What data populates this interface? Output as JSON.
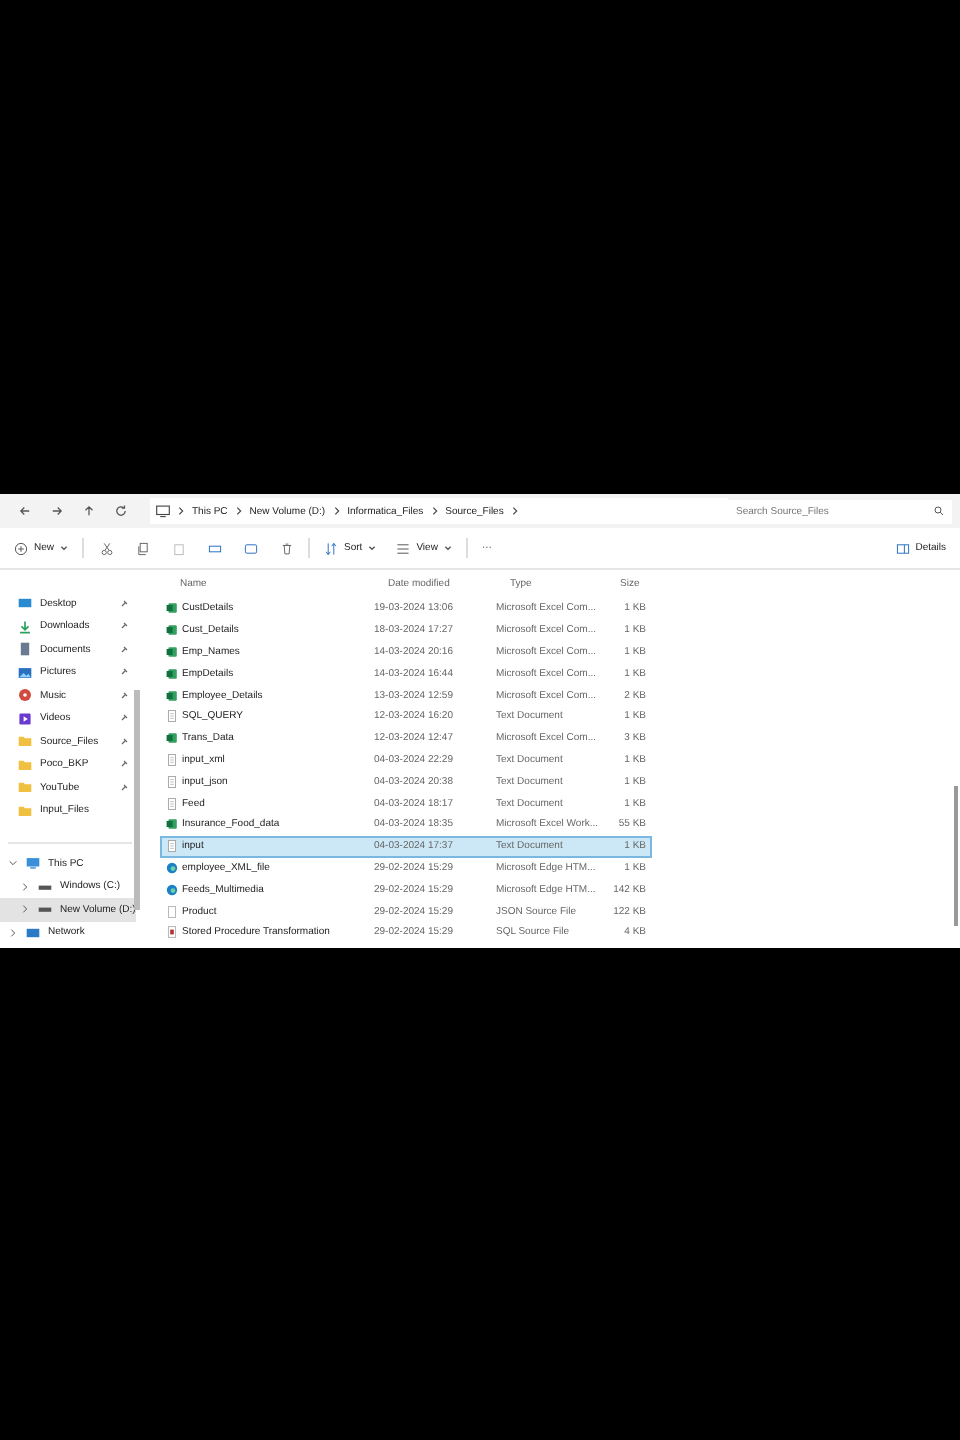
{
  "address_bar": {
    "crumbs": [
      "This PC",
      "New Volume (D:)",
      "Informatica_Files",
      "Source_Files"
    ],
    "search": {
      "placeholder": "Search Source_Files"
    }
  },
  "toolbar": {
    "new": "New",
    "sort": "Sort",
    "view": "View",
    "more": "···",
    "details": "Details"
  },
  "sidebar": {
    "quick_access": [
      {
        "label": "Desktop",
        "pinned": true
      },
      {
        "label": "Downloads",
        "pinned": true
      },
      {
        "label": "Documents",
        "pinned": true
      },
      {
        "label": "Pictures",
        "pinned": true
      },
      {
        "label": "Music",
        "pinned": true
      },
      {
        "label": "Videos",
        "pinned": true
      },
      {
        "label": "Source_Files",
        "pinned": true
      },
      {
        "label": "Poco_BKP",
        "pinned": true
      },
      {
        "label": "YouTube",
        "pinned": true
      },
      {
        "label": "Input_Files",
        "pinned": false
      }
    ],
    "tree": [
      {
        "label": "This PC",
        "expanded": true,
        "selected": false,
        "children": [
          {
            "label": "Windows (C:)",
            "expanded": false,
            "selected": false
          },
          {
            "label": "New Volume (D:)",
            "expanded": false,
            "selected": true
          }
        ]
      },
      {
        "label": "Network",
        "expanded": false,
        "selected": false
      }
    ]
  },
  "table": {
    "columns": [
      "Name",
      "Date modified",
      "Type",
      "Size"
    ],
    "rows": [
      {
        "kind": "excel",
        "name": "CustDetails",
        "date": "19-03-2024 13:06",
        "type": "Microsoft Excel Com...",
        "size": "1 KB",
        "selected": false
      },
      {
        "kind": "excel",
        "name": "Cust_Details",
        "date": "18-03-2024 17:27",
        "type": "Microsoft Excel Com...",
        "size": "1 KB",
        "selected": false
      },
      {
        "kind": "excel",
        "name": "Emp_Names",
        "date": "14-03-2024 20:16",
        "type": "Microsoft Excel Com...",
        "size": "1 KB",
        "selected": false
      },
      {
        "kind": "excel",
        "name": "EmpDetails",
        "date": "14-03-2024 16:44",
        "type": "Microsoft Excel Com...",
        "size": "1 KB",
        "selected": false
      },
      {
        "kind": "excel",
        "name": "Employee_Details",
        "date": "13-03-2024 12:59",
        "type": "Microsoft Excel Com...",
        "size": "2 KB",
        "selected": false
      },
      {
        "kind": "text",
        "name": "SQL_QUERY",
        "date": "12-03-2024 16:20",
        "type": "Text Document",
        "size": "1 KB",
        "selected": false
      },
      {
        "kind": "excel",
        "name": "Trans_Data",
        "date": "12-03-2024 12:47",
        "type": "Microsoft Excel Com...",
        "size": "3 KB",
        "selected": false
      },
      {
        "kind": "text",
        "name": "input_xml",
        "date": "04-03-2024 22:29",
        "type": "Text Document",
        "size": "1 KB",
        "selected": false
      },
      {
        "kind": "text",
        "name": "input_json",
        "date": "04-03-2024 20:38",
        "type": "Text Document",
        "size": "1 KB",
        "selected": false
      },
      {
        "kind": "text",
        "name": "Feed",
        "date": "04-03-2024 18:17",
        "type": "Text Document",
        "size": "1 KB",
        "selected": false
      },
      {
        "kind": "excel",
        "name": "Insurance_Food_data",
        "date": "04-03-2024 18:35",
        "type": "Microsoft Excel Work...",
        "size": "55 KB",
        "selected": false
      },
      {
        "kind": "text",
        "name": "input",
        "date": "04-03-2024 17:37",
        "type": "Text Document",
        "size": "1 KB",
        "selected": true
      },
      {
        "kind": "edge",
        "name": "employee_XML_file",
        "date": "29-02-2024 15:29",
        "type": "Microsoft Edge HTM...",
        "size": "1 KB",
        "selected": false
      },
      {
        "kind": "edge",
        "name": "Feeds_Multimedia",
        "date": "29-02-2024 15:29",
        "type": "Microsoft Edge HTM...",
        "size": "142 KB",
        "selected": false
      },
      {
        "kind": "json",
        "name": "Product",
        "date": "29-02-2024 15:29",
        "type": "JSON Source File",
        "size": "122 KB",
        "selected": false
      },
      {
        "kind": "sql",
        "name": "Stored Procedure Transformation",
        "date": "29-02-2024 15:29",
        "type": "SQL Source File",
        "size": "4 KB",
        "selected": false
      }
    ]
  }
}
